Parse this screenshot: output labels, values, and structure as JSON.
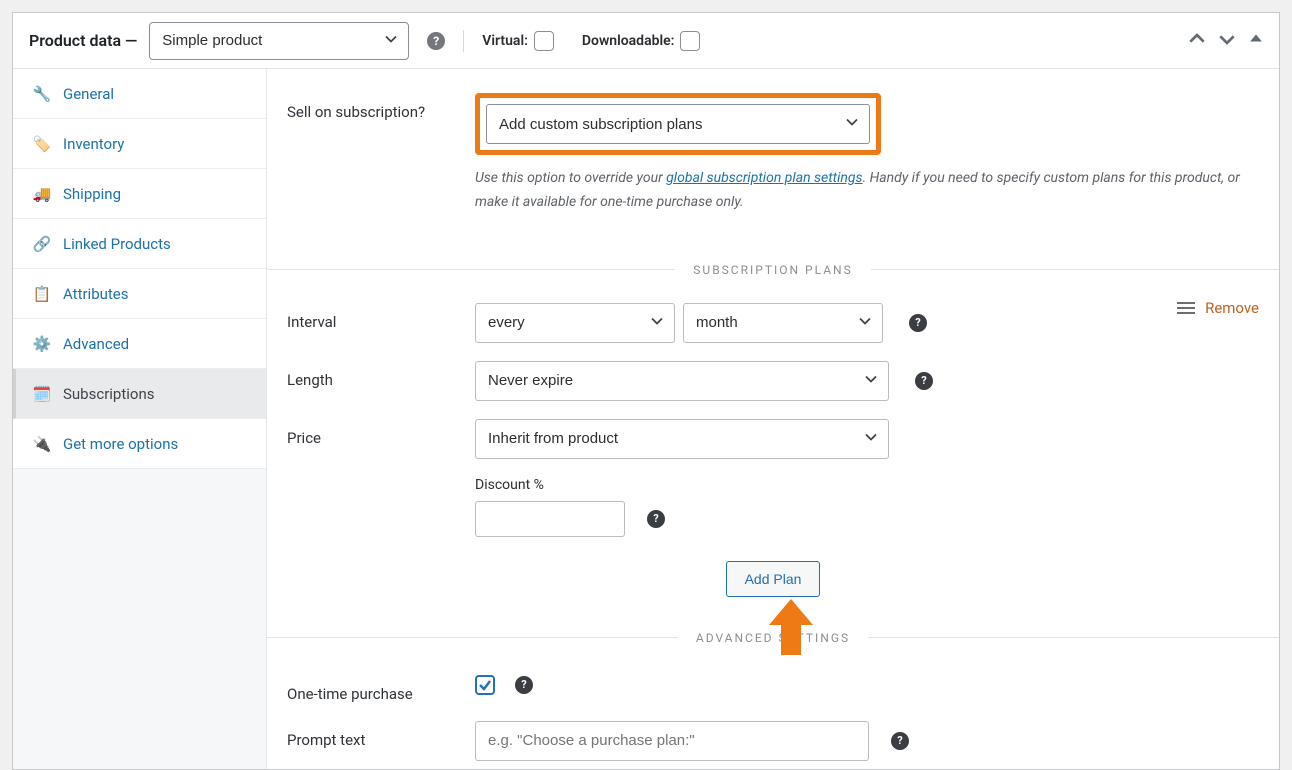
{
  "header": {
    "title": "Product data —",
    "product_type": "Simple product",
    "virtual_label": "Virtual:",
    "downloadable_label": "Downloadable:"
  },
  "tabs": {
    "general": "General",
    "inventory": "Inventory",
    "shipping": "Shipping",
    "linked": "Linked Products",
    "attributes": "Attributes",
    "advanced": "Advanced",
    "subscriptions": "Subscriptions",
    "more": "Get more options"
  },
  "sell": {
    "label": "Sell on subscription?",
    "select": "Add custom subscription plans",
    "hint_pre": "Use this option to override your ",
    "hint_link": "global subscription plan settings",
    "hint_post": ". Handy if you need to specify custom plans for this product, or make it available for one-time purchase only."
  },
  "section_plans": "SUBSCRIPTION PLANS",
  "plan": {
    "remove": "Remove",
    "interval_label": "Interval",
    "interval_freq": "every",
    "interval_unit": "month",
    "length_label": "Length",
    "length_value": "Never expire",
    "price_label": "Price",
    "price_value": "Inherit from product",
    "discount_label": "Discount %",
    "add_plan": "Add Plan"
  },
  "section_advanced": "ADVANCED SETTINGS",
  "adv": {
    "onetime_label": "One-time purchase",
    "prompt_label": "Prompt text",
    "prompt_placeholder": "e.g. \"Choose a purchase plan:\""
  }
}
